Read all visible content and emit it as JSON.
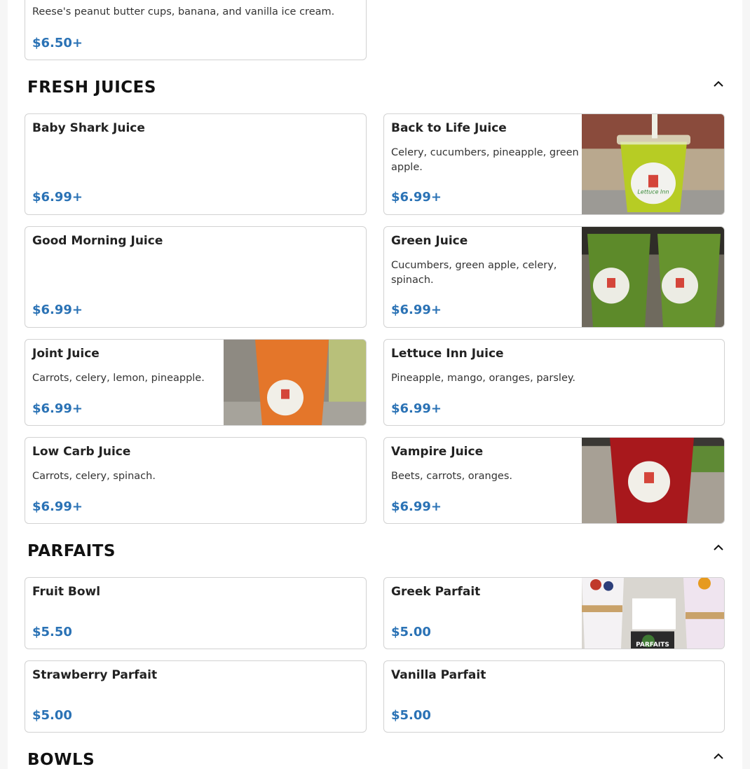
{
  "top_card": {
    "desc": "Reese's peanut butter cups, banana, and vanilla ice cream.",
    "price": "$6.50+"
  },
  "sections": {
    "juices": {
      "title": "FRESH JUICES",
      "items": [
        {
          "name": "Baby Shark Juice",
          "desc": "",
          "price": "$6.99+"
        },
        {
          "name": "Back to Life Juice",
          "desc": "Celery, cucumbers, pineapple, green apple.",
          "price": "$6.99+",
          "image": "green-juice-cup-photo"
        },
        {
          "name": "Good Morning Juice",
          "desc": "",
          "price": "$6.99+"
        },
        {
          "name": "Green Juice",
          "desc": "Cucumbers, green apple, celery, spinach.",
          "price": "$6.99+",
          "image": "two-green-juices-photo"
        },
        {
          "name": "Joint Juice",
          "desc": "Carrots, celery, lemon, pineapple.",
          "price": "$6.99+",
          "image": "orange-juice-cup-photo"
        },
        {
          "name": "Lettuce Inn Juice",
          "desc": "Pineapple, mango, oranges, parsley.",
          "price": "$6.99+"
        },
        {
          "name": "Low Carb Juice",
          "desc": "Carrots, celery, spinach.",
          "price": "$6.99+"
        },
        {
          "name": "Vampire Juice",
          "desc": "Beets, carrots, oranges.",
          "price": "$6.99+",
          "image": "red-juice-cup-photo"
        }
      ]
    },
    "parfaits": {
      "title": "PARFAITS",
      "items": [
        {
          "name": "Fruit Bowl",
          "price": "$5.50"
        },
        {
          "name": "Greek Parfait",
          "price": "$5.00",
          "image": "parfait-cups-photo",
          "image_caption": "PARFAITS"
        },
        {
          "name": "Strawberry Parfait",
          "price": "$5.00"
        },
        {
          "name": "Vanilla Parfait",
          "price": "$5.00"
        }
      ]
    },
    "bowls": {
      "title": "BOWLS"
    }
  },
  "icons": {
    "collapse": "chevron-up-icon"
  },
  "colors": {
    "price": "#2a72b5",
    "border": "#d2d2d2"
  }
}
